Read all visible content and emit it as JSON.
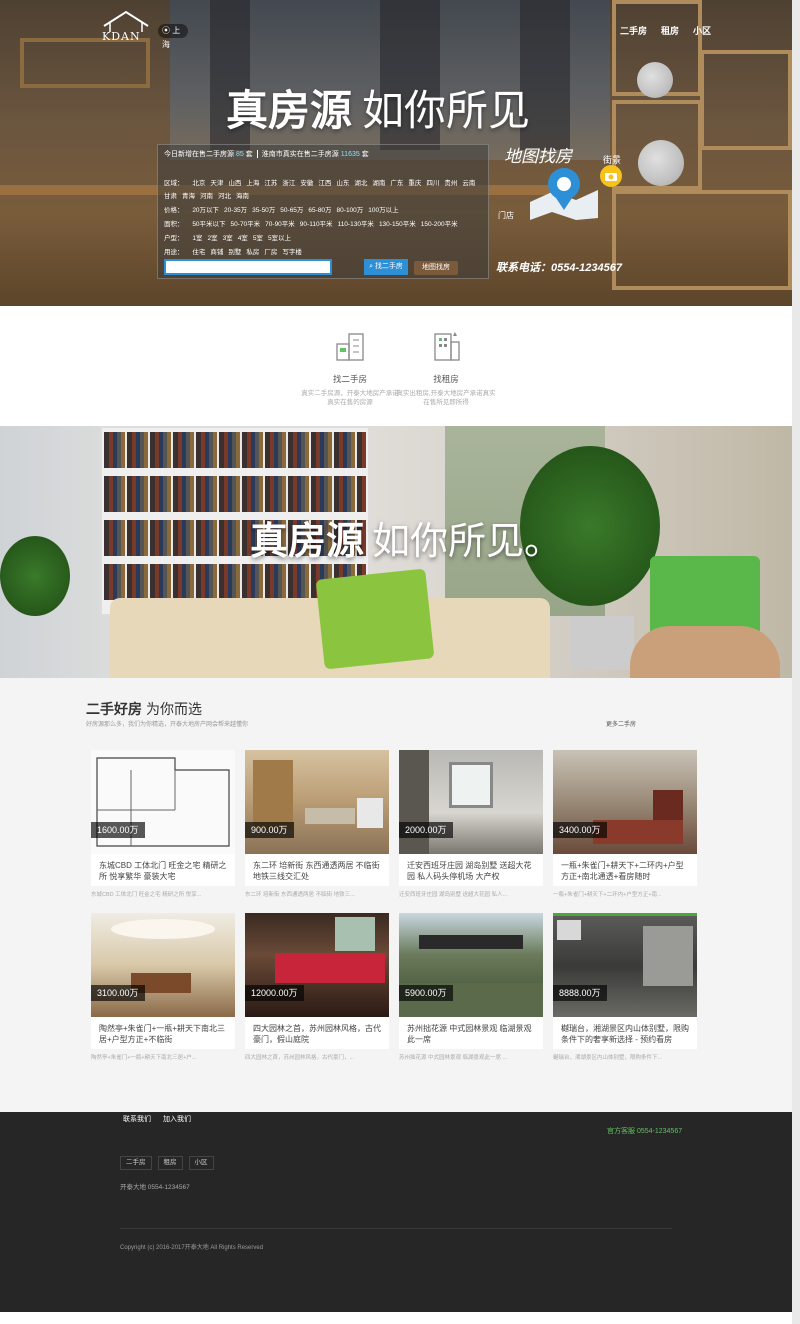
{
  "header": {
    "logo_text": "KDAN",
    "city": "上海",
    "nav": [
      "二手房",
      "租房",
      "小区"
    ]
  },
  "hero": {
    "title_bold": "真房源",
    "title_rest": "如你所见",
    "stats": {
      "label1": "今日新增在售二手房源",
      "count1": "85",
      "unit1": "套",
      "label2": "淮南市真实在售二手房源",
      "count2": "11635",
      "unit2": "套"
    },
    "filters": {
      "region_label": "区域：",
      "regions_row1": [
        "北京",
        "天津",
        "山西",
        "上海",
        "江苏",
        "浙江",
        "安徽",
        "江西",
        "山东",
        "湖北",
        "湖南",
        "广东",
        "重庆",
        "四川",
        "贵州",
        "云南"
      ],
      "regions_row2": [
        "甘肃",
        "青海",
        "河南",
        "河北",
        "海南"
      ],
      "price_label": "价格：",
      "prices": [
        "20万以下",
        "20-35万",
        "35-50万",
        "50-65万",
        "65-80万",
        "80-100万",
        "100万以上"
      ],
      "area_label": "面积：",
      "areas": [
        "50平米以下",
        "50-70平米",
        "70-90平米",
        "90-110平米",
        "110-130平米",
        "130-150平米",
        "150-200平米"
      ],
      "type_label": "户型：",
      "types": [
        "1室",
        "2室",
        "3室",
        "4室",
        "5室",
        "5室以上"
      ],
      "use_label": "用途：",
      "uses": [
        "住宅",
        "商铺",
        "别墅",
        "私房",
        "厂房",
        "写字楼"
      ]
    },
    "search_placeholder": "",
    "search_button": "找二手房",
    "map_button": "地图找房",
    "map_search_label": "地图找房",
    "street_label": "街景",
    "store_label": "门店",
    "phone": "联系电话：0554-1234567"
  },
  "services": [
    {
      "title": "找二手房",
      "desc1": "真实二手房源，开泰大地房产承诺",
      "desc2": "真实在售的房源",
      "icon": "building-icon"
    },
    {
      "title": "找租房",
      "desc1": "真实出租房,开泰大地房产承诺真实",
      "desc2": "在售所见即所得",
      "icon": "apartment-icon"
    }
  ],
  "banner": {
    "title_bold": "真房源",
    "title_rest": "如你所见。"
  },
  "listings": {
    "title_bold": "二手好房",
    "title_rest": "为你而选",
    "subtitle": "好房源那么多，我们为你精选，开泰大地房产网会帮来越懂你",
    "more": "更多二手房",
    "items": [
      {
        "price": "1600.00万",
        "title": "东城CBD 工体北门 旺金之宅 精研之所 悦享繁华 豪装大宅",
        "sub": "东城CBD 工体北门 旺金之宅 精研之所 悦享..."
      },
      {
        "price": "900.00万",
        "title": "东二环 培新街 东西通透两居 不临街 地铁三线交汇处",
        "sub": "东二环 培新街 东西通透两居 不临街 地铁三..."
      },
      {
        "price": "2000.00万",
        "title": "迁安西班牙庄园 湖岛别墅 送超大花园 私人码头停机场 大产权",
        "sub": "迁安西班牙庄园 湖岛别墅 送超大花园 私人..."
      },
      {
        "price": "3400.00万",
        "title": "一瓶+朱雀门+耕天下+二环内+户型方正+南北通透+看房随时",
        "sub": "一瓶+朱雀门+耕天下+二环内+户型方正+南..."
      },
      {
        "price": "3100.00万",
        "title": "陶然亭+朱雀门+一瓶+耕天下南北三居+户型方正+不临街",
        "sub": "陶然亭+朱雀门+一瓶+耕天下南北三居+户..."
      },
      {
        "price": "12000.00万",
        "title": "四大园林之首，苏州园林风格，古代豪门，假山庭院",
        "sub": "四大园林之首，苏州园林风格，古代豪门，..."
      },
      {
        "price": "5900.00万",
        "title": "苏州拙花源 中式园林景观 临湖景观此一席",
        "sub": "苏州拙花源 中式园林景观 临湖景观此一席 ..."
      },
      {
        "price": "8888.00万",
        "title": "樾瑞台，湘湖景区内山体别墅，限购条件下的奢享新选择 - 预约看房",
        "sub": "樾瑞台，湘湖景区内山体别墅，限购条件下..."
      }
    ]
  },
  "footer": {
    "links": [
      "联系我们",
      "加入我们"
    ],
    "service": "官方客服 0554-1234567",
    "tags": [
      "二手房",
      "租房",
      "小区"
    ],
    "contact": "开泰大地 0554-1234567",
    "copyright": "Copyright (c) 2016-2017开泰大地 All Rights Reserved"
  },
  "colors": {
    "accent": "#2d8fd5",
    "green": "#5fc35f",
    "footer_bg": "#262626"
  }
}
